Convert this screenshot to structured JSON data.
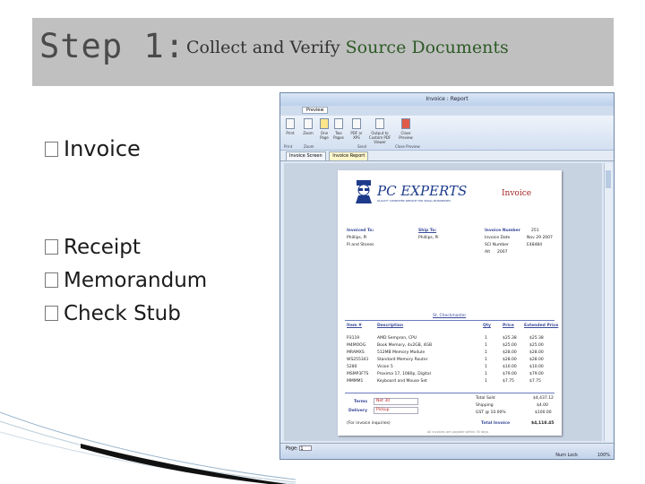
{
  "banner": {
    "step": "Step 1:",
    "subtitle_a": "Collect and Verify",
    "subtitle_b": "Source Documents"
  },
  "bullets": [
    "Invoice",
    "Receipt",
    "Memorandum",
    "Check Stub"
  ],
  "window": {
    "title": "Invoice : Report",
    "ribbon_tab": "Preview",
    "buttons": [
      "Print",
      "Zoom",
      "One Page",
      "Two Pages",
      "PDF or XPS",
      "Output to Custom PDF Viewer",
      "Close Preview"
    ],
    "groups": [
      "Print",
      "Zoom",
      "Send",
      "Close Preview"
    ],
    "doc_tabs": [
      "Invoice Screen",
      "Invoice Report"
    ],
    "status_left": "Page:",
    "page_number": "1",
    "status_right": "Num Lock",
    "zoom_level": "100%"
  },
  "invoice": {
    "brand": "PC EXPERTS",
    "brand_tagline": "QUALITY COMPUTER SERVICE FOR SMALL BUSINESSES",
    "title": "Invoice",
    "invoiced_to_label": "Invoiced To:",
    "invoiced_to_name": "Phillips, Pi",
    "invoiced_to_company": "Pi and Stones",
    "ship_to_label": "Ship To:",
    "ship_to_name": "Phillips, Pi",
    "invoice_number_label": "Invoice Number",
    "invoice_number": "251",
    "invoice_date_label": "Invoice Date",
    "invoice_date": "Nov 29 2007",
    "sales_label": "SCI Number",
    "sales_value": "E48484",
    "account_label": "Alt",
    "account_value": "2007",
    "ship_via": "St. Checkmaster",
    "columns": [
      "Item #",
      "Description",
      "Qty",
      "Price",
      "Extended Price"
    ],
    "items": [
      {
        "item": "P3119",
        "desc": "AMD Sempron, CPU",
        "qty": "1",
        "price": "$25.38",
        "ext": "$25.38"
      },
      {
        "item": "M4MOOG",
        "desc": "Book Memory, 4x2GB, 4GB",
        "qty": "1",
        "price": "$25.00",
        "ext": "$25.00"
      },
      {
        "item": "MRAMXS",
        "desc": "512MB Memory Module",
        "qty": "1",
        "price": "$28.00",
        "ext": "$28.00"
      },
      {
        "item": "WS255341",
        "desc": "Standard Memory Router",
        "qty": "1",
        "price": "$28.00",
        "ext": "$28.00"
      },
      {
        "item": "5280",
        "desc": "Vision 5",
        "qty": "1",
        "price": "$10.00",
        "ext": "$10.00"
      },
      {
        "item": "MSMP3FTS",
        "desc": "Proxima 17, 1080p, Digital",
        "qty": "1",
        "price": "$79.00",
        "ext": "$79.00"
      },
      {
        "item": "MMMM1",
        "desc": "Keyboard and Mouse Set",
        "qty": "1",
        "price": "$7.75",
        "ext": "$7.75"
      }
    ],
    "terms_label": "Terms",
    "terms_value": "Net 30",
    "delivery_label": "Delivery",
    "delivery_value": "Pickup",
    "total_sold_label": "Total Sold",
    "total_sold": "$4,437.12",
    "shipping_label": "Shipping",
    "shipping": "$4.00",
    "tax_label": "GST @ 10.00%",
    "tax": "$100.00",
    "total_label": "Total Invoice",
    "total": "$4,118.45",
    "footer_left": "(For invoice inquiries)",
    "footer_note": "All invoices are payable within 30 days"
  }
}
